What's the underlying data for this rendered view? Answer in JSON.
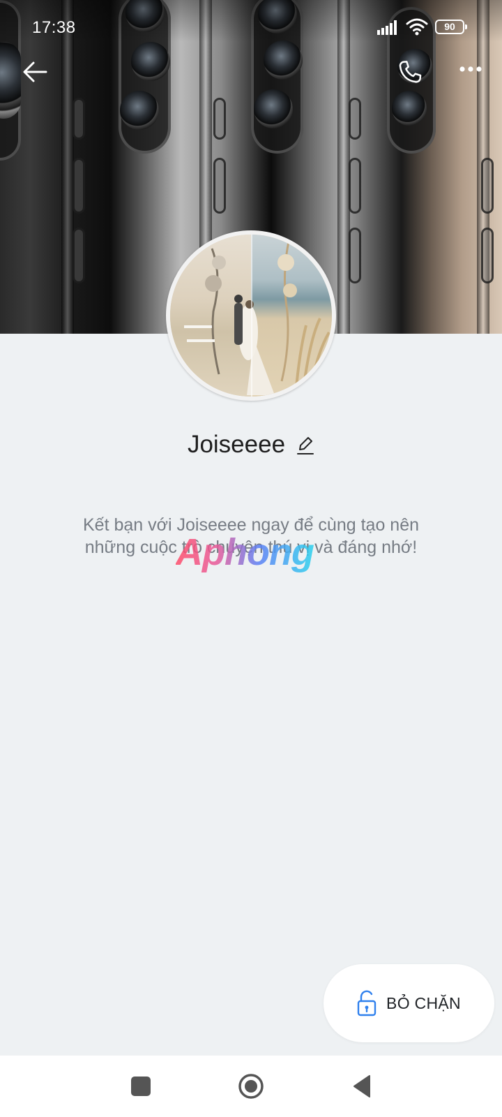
{
  "status_bar": {
    "time": "17:38",
    "battery": "90"
  },
  "header": {
    "back_icon": "arrow-left-icon",
    "call_icon": "phone-icon",
    "more_icon": "more-horizontal-icon"
  },
  "profile": {
    "name": "Joiseeee",
    "edit_icon": "pencil-icon",
    "intro": "Kết bạn với Joiseeee ngay để cùng tạo nên những cuộc trò chuyện thú vị và đáng nhớ!"
  },
  "watermark": {
    "text": "Aphong"
  },
  "actions": {
    "unblock_label": "BỎ CHẶN",
    "unblock_icon": "unlock-icon"
  },
  "colors": {
    "background": "#eef1f3",
    "accent": "#2f80ed",
    "text_muted": "#767c84"
  }
}
